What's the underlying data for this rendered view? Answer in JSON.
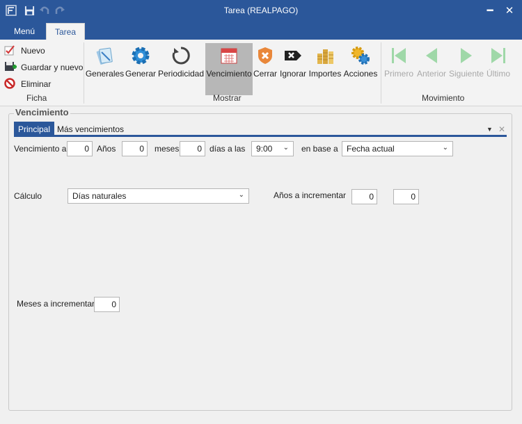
{
  "window": {
    "title": "Tarea (REALPAGO)",
    "minimize_glyph": "━",
    "close_glyph": "✕"
  },
  "tabs": {
    "menu": "Menú",
    "tarea": "Tarea"
  },
  "ribbon": {
    "ficha": {
      "label": "Ficha",
      "nuevo": "Nuevo",
      "guardar_nuevo": "Guardar y nuevo",
      "eliminar": "Eliminar"
    },
    "mostrar": {
      "label": "Mostrar",
      "generales": "Generales",
      "generar": "Generar",
      "periodicidad": "Periodicidad",
      "vencimiento": "Vencimiento",
      "cerrar": "Cerrar",
      "ignorar": "Ignorar",
      "importes": "Importes",
      "acciones": "Acciones"
    },
    "movimiento": {
      "label": "Movimiento",
      "primero": "Primero",
      "anterior": "Anterior",
      "siguiente": "Siguiente",
      "ultimo": "Último"
    }
  },
  "section": {
    "title": "Vencimiento",
    "tabs": {
      "principal": "Principal",
      "mas": "Más vencimientos"
    },
    "pin_glyph": "▼",
    "close_glyph": "✕"
  },
  "form": {
    "vencimiento_label": "Vencimiento a",
    "anos_value": "0",
    "anos_label": "Años",
    "meses_value": "0",
    "meses_label": "meses",
    "dias_value": "0",
    "dias_label": "días  a las",
    "hora": "9:00",
    "base_label": "en base a",
    "base": "Fecha actual",
    "calculo_label": "Cálculo",
    "calculo": "Días naturales",
    "anos_incr_label": "Años a incrementar",
    "anos_incr_1": "0",
    "anos_incr_2": "0",
    "meses_incr_label": "Meses a incrementar",
    "meses_incr": "0"
  },
  "colors": {
    "accent": "#2b579a",
    "active_button": "#b7b7b7"
  }
}
